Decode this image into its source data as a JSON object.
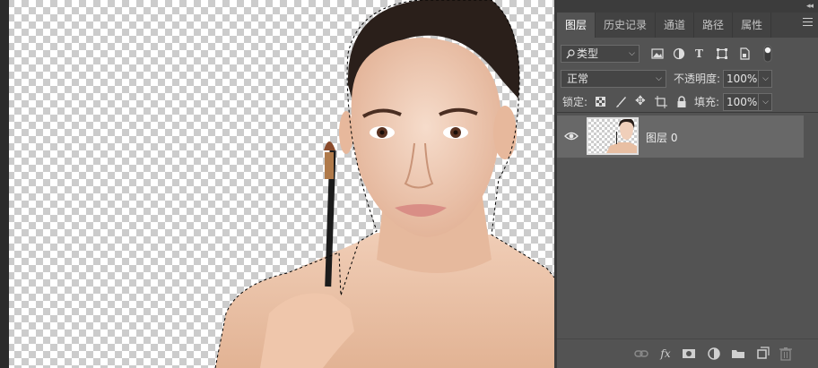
{
  "panel": {
    "collapse_icon": "double-chevron-left-icon",
    "tabs": [
      {
        "label": "图层",
        "active": true
      },
      {
        "label": "历史记录",
        "active": false
      },
      {
        "label": "通道",
        "active": false
      },
      {
        "label": "路径",
        "active": false
      },
      {
        "label": "属性",
        "active": false
      }
    ],
    "menu_icon": "hamburger-menu-icon"
  },
  "filter": {
    "kind_label": "类型",
    "icons": [
      "image-filter-icon",
      "adjustment-filter-icon",
      "type-filter-icon",
      "shape-filter-icon",
      "smart-object-filter-icon",
      "filter-toggle-icon"
    ]
  },
  "blend": {
    "mode": "正常",
    "opacity_label": "不透明度:",
    "opacity_value": "100%"
  },
  "lock": {
    "label": "锁定:",
    "icons": [
      "lock-transparent-icon",
      "lock-image-icon",
      "lock-position-icon",
      "lock-artboard-icon",
      "lock-all-icon"
    ],
    "fill_label": "填充:",
    "fill_value": "100%"
  },
  "layers": [
    {
      "name": "图层 0",
      "visible": true,
      "selected": true
    }
  ],
  "bottom_icons": [
    "link-layers-icon",
    "fx-icon",
    "add-mask-icon",
    "adjustment-layer-icon",
    "new-group-icon",
    "new-layer-icon",
    "trash-icon"
  ],
  "bottom_fx_label": "fx",
  "colors": {
    "panel_bg": "#535353",
    "tab_bar_bg": "#424242",
    "selected_layer_bg": "#686868"
  }
}
